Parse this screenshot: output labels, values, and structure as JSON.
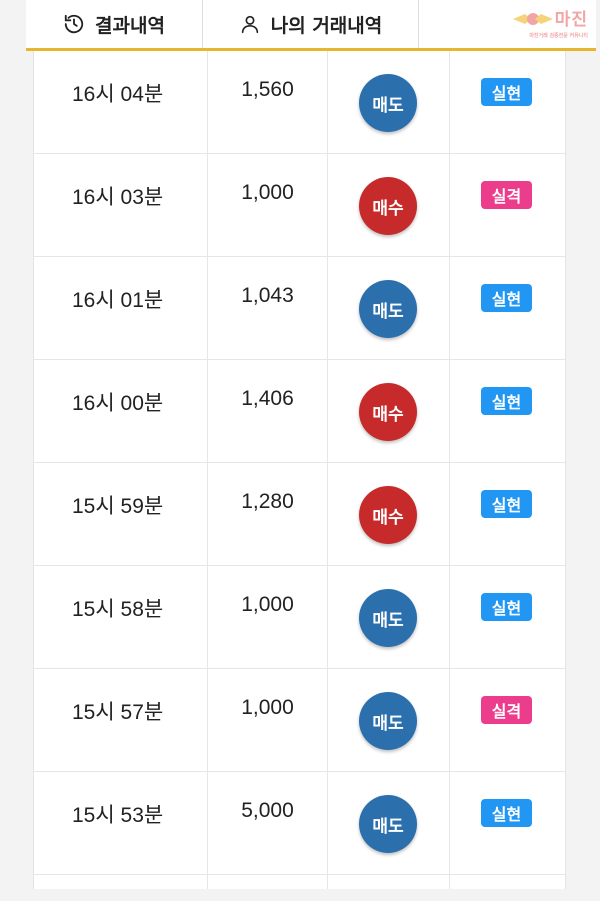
{
  "tabs": [
    {
      "label": "결과내역",
      "icon": "history-icon"
    },
    {
      "label": "나의 거래내역",
      "icon": "user-icon"
    }
  ],
  "logo": {
    "text": "마진",
    "sub": "마진거래 검증전문 커뮤니티"
  },
  "colors": {
    "sell": "#2b6fad",
    "buy": "#c62a2a",
    "realized": "#2196f3",
    "loss": "#ec3c8c",
    "accent": "#e8b52c"
  },
  "rows": [
    {
      "time": "16시 04분",
      "amount": "1,560",
      "side": "매도",
      "side_type": "sell",
      "result": "실현",
      "result_type": "realized"
    },
    {
      "time": "16시 03분",
      "amount": "1,000",
      "side": "매수",
      "side_type": "buy",
      "result": "실격",
      "result_type": "loss"
    },
    {
      "time": "16시 01분",
      "amount": "1,043",
      "side": "매도",
      "side_type": "sell",
      "result": "실현",
      "result_type": "realized"
    },
    {
      "time": "16시 00분",
      "amount": "1,406",
      "side": "매수",
      "side_type": "buy",
      "result": "실현",
      "result_type": "realized"
    },
    {
      "time": "15시 59분",
      "amount": "1,280",
      "side": "매수",
      "side_type": "buy",
      "result": "실현",
      "result_type": "realized"
    },
    {
      "time": "15시 58분",
      "amount": "1,000",
      "side": "매도",
      "side_type": "sell",
      "result": "실현",
      "result_type": "realized"
    },
    {
      "time": "15시 57분",
      "amount": "1,000",
      "side": "매도",
      "side_type": "sell",
      "result": "실격",
      "result_type": "loss"
    },
    {
      "time": "15시 53분",
      "amount": "5,000",
      "side": "매도",
      "side_type": "sell",
      "result": "실현",
      "result_type": "realized"
    }
  ]
}
